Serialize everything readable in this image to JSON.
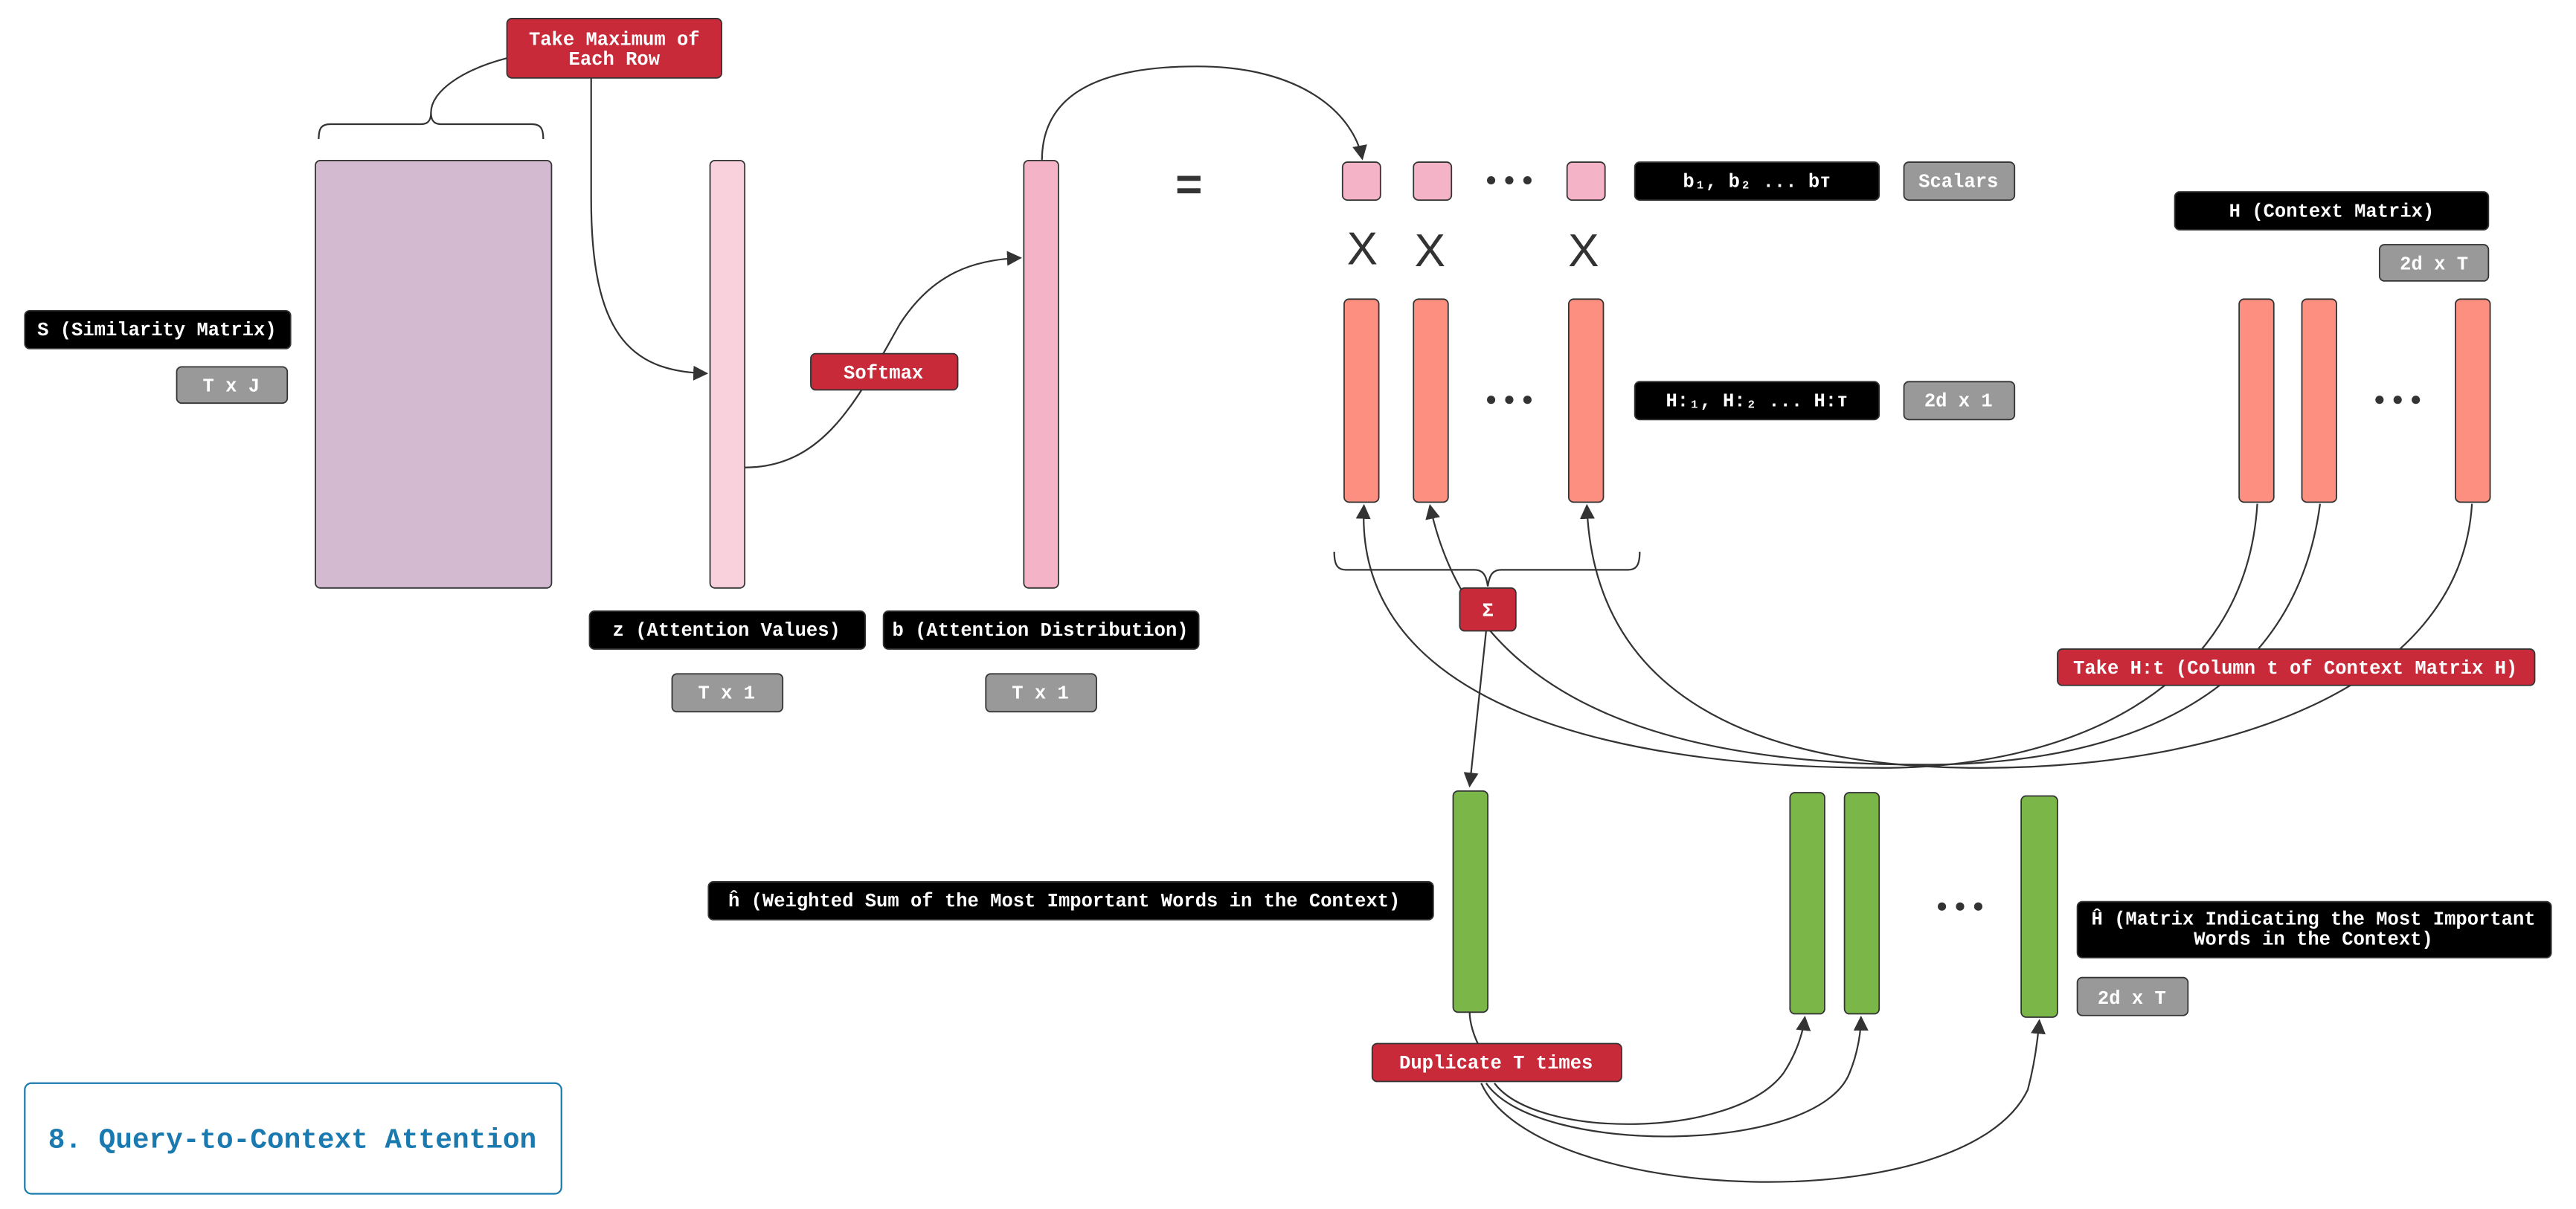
{
  "title": "8. Query-to-Context Attention",
  "colors": {
    "label_bg": "#000000",
    "dim_bg": "#999999",
    "operation_bg": "#c92a3a",
    "similarity_matrix": "#d3bad0",
    "attention_values": "#f9d1dc",
    "attention_distribution": "#f4b3c6",
    "context_columns": "#fc8f80",
    "output_vectors": "#7ab648",
    "title": "#1a7ab0"
  },
  "similarity": {
    "label": "S (Similarity Matrix)",
    "dims": "T x J"
  },
  "operations": {
    "max_row_line1": "Take Maximum of",
    "max_row_line2": "Each Row",
    "softmax": "Softmax",
    "sum": "Σ",
    "take_column": "Take H:t (Column t of Context Matrix H)",
    "duplicate": "Duplicate T times"
  },
  "attention_values": {
    "label": "z (Attention Values)",
    "dims": "T x 1"
  },
  "attention_distribution": {
    "label": "b (Attention Distribution)",
    "dims": "T x 1"
  },
  "equals": "=",
  "multiply": "X",
  "scalars": {
    "label": "b₁, b₂ ... bᴛ",
    "dims": "Scalars"
  },
  "columns": {
    "label": "H:₁, H:₂ ... H:ᴛ",
    "dims": "2d x 1"
  },
  "context_matrix": {
    "label": "H (Context Matrix)",
    "dims": "2d x T"
  },
  "weighted_sum": {
    "label": "ĥ (Weighted Sum of the Most Important Words in the Context)"
  },
  "output_matrix": {
    "label_line1": "Ĥ (Matrix Indicating the Most Important",
    "label_line2": "Words in the Context)",
    "dims": "2d x T"
  }
}
